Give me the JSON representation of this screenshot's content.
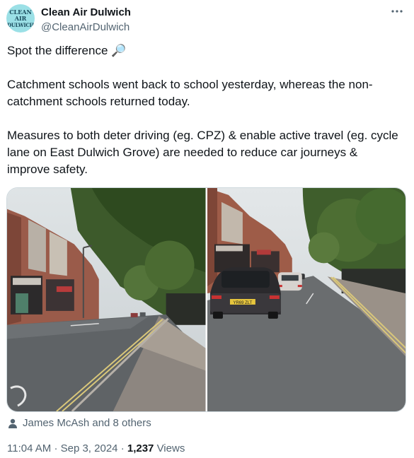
{
  "author": {
    "display_name": "Clean Air Dulwich",
    "handle": "@CleanAirDulwich",
    "avatar_lines": [
      "CLEAN",
      "AIR",
      "DULWICH"
    ]
  },
  "tweet": {
    "text": "Spot the difference 🔎\n\nCatchment schools went back to school yesterday, whereas the non-catchment schools returned today.\n\nMeasures to both deter driving (eg. CPZ) & enable active travel (eg. cycle lane on East Dulwich Grove) are needed to reduce car journeys & improve safety."
  },
  "media": {
    "photos": [
      {
        "description": "street-empty-road"
      },
      {
        "description": "street-queue-of-cars",
        "plate_text": "YR69 ZLT"
      }
    ]
  },
  "social_context": {
    "liked_by": "James McAsh and 8 others"
  },
  "meta": {
    "time": "11:04 AM",
    "separator": "·",
    "date": "Sep 3, 2024",
    "views_count": "1,237",
    "views_label": "Views"
  },
  "colors": {
    "text_primary": "#0f1419",
    "text_secondary": "#536471",
    "border": "#cfd9de",
    "avatar_bg": "#9be0e6"
  },
  "icons": {
    "more": "more-horizontal-icon",
    "person": "person-icon"
  }
}
